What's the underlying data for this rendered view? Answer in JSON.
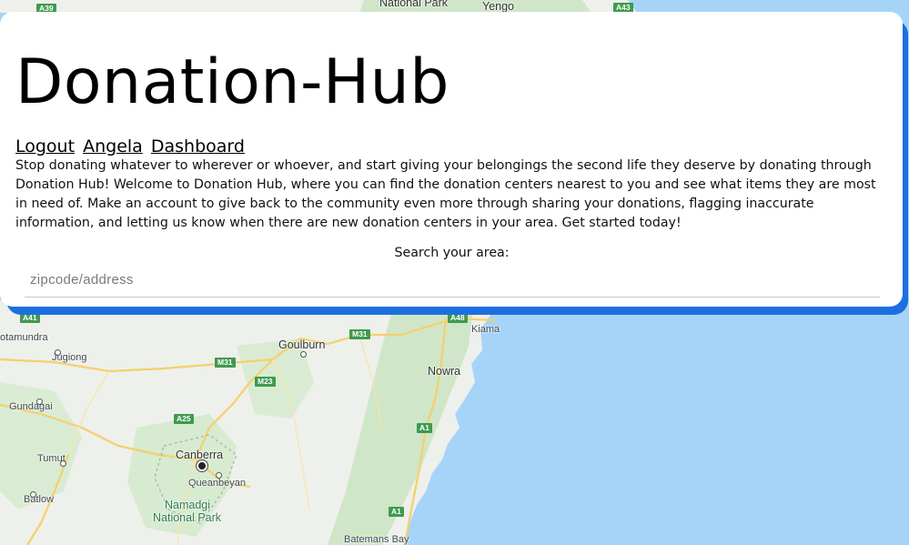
{
  "app": {
    "title": "Donation-Hub"
  },
  "nav": {
    "logout": "Logout",
    "user": "Angela",
    "dashboard": "Dashboard"
  },
  "intro": "Stop donating whatever to wherever or whoever, and start giving your belongings the second life they deserve by donating through Donation Hub! Welcome to Donation Hub, where you can find the donation centers nearest to you and see what items they are most in need of. Make an account to give back to the community even more through sharing your donations, flagging inaccurate information, and letting us know when there are new donation centers in your area. Get started today!",
  "search": {
    "label": "Search your area:",
    "placeholder": "zipcode/address",
    "value": ""
  },
  "map": {
    "places": {
      "national_park_top": "National Park",
      "yengo": "Yengo",
      "cootamundra": "otamundra",
      "goulburn": "Goulburn",
      "kiama": "Kiama",
      "jugiong": "Jugiong",
      "nowra": "Nowra",
      "gundagai": "Gundagai",
      "tumut": "Tumut",
      "canberra": "Canberra",
      "queanbeyan": "Queanbeyan",
      "namadgi": "Namadgi",
      "national_park": "National Park",
      "batlow": "Batlow",
      "batemans_bay": "Batemans Bay"
    },
    "routes": {
      "a39": "A39",
      "a43": "A43",
      "a41": "A41",
      "m31a": "M31",
      "a48": "A48",
      "m31b": "M31",
      "m23": "M23",
      "a25": "A25",
      "a1a": "A1",
      "a1b": "A1"
    },
    "colors": {
      "land": "#eef0ec",
      "park": "#c7e3c4",
      "water": "#a6d4f8",
      "road": "#f6cf6b"
    }
  },
  "theme": {
    "card_accent": "#1d6fe0"
  }
}
